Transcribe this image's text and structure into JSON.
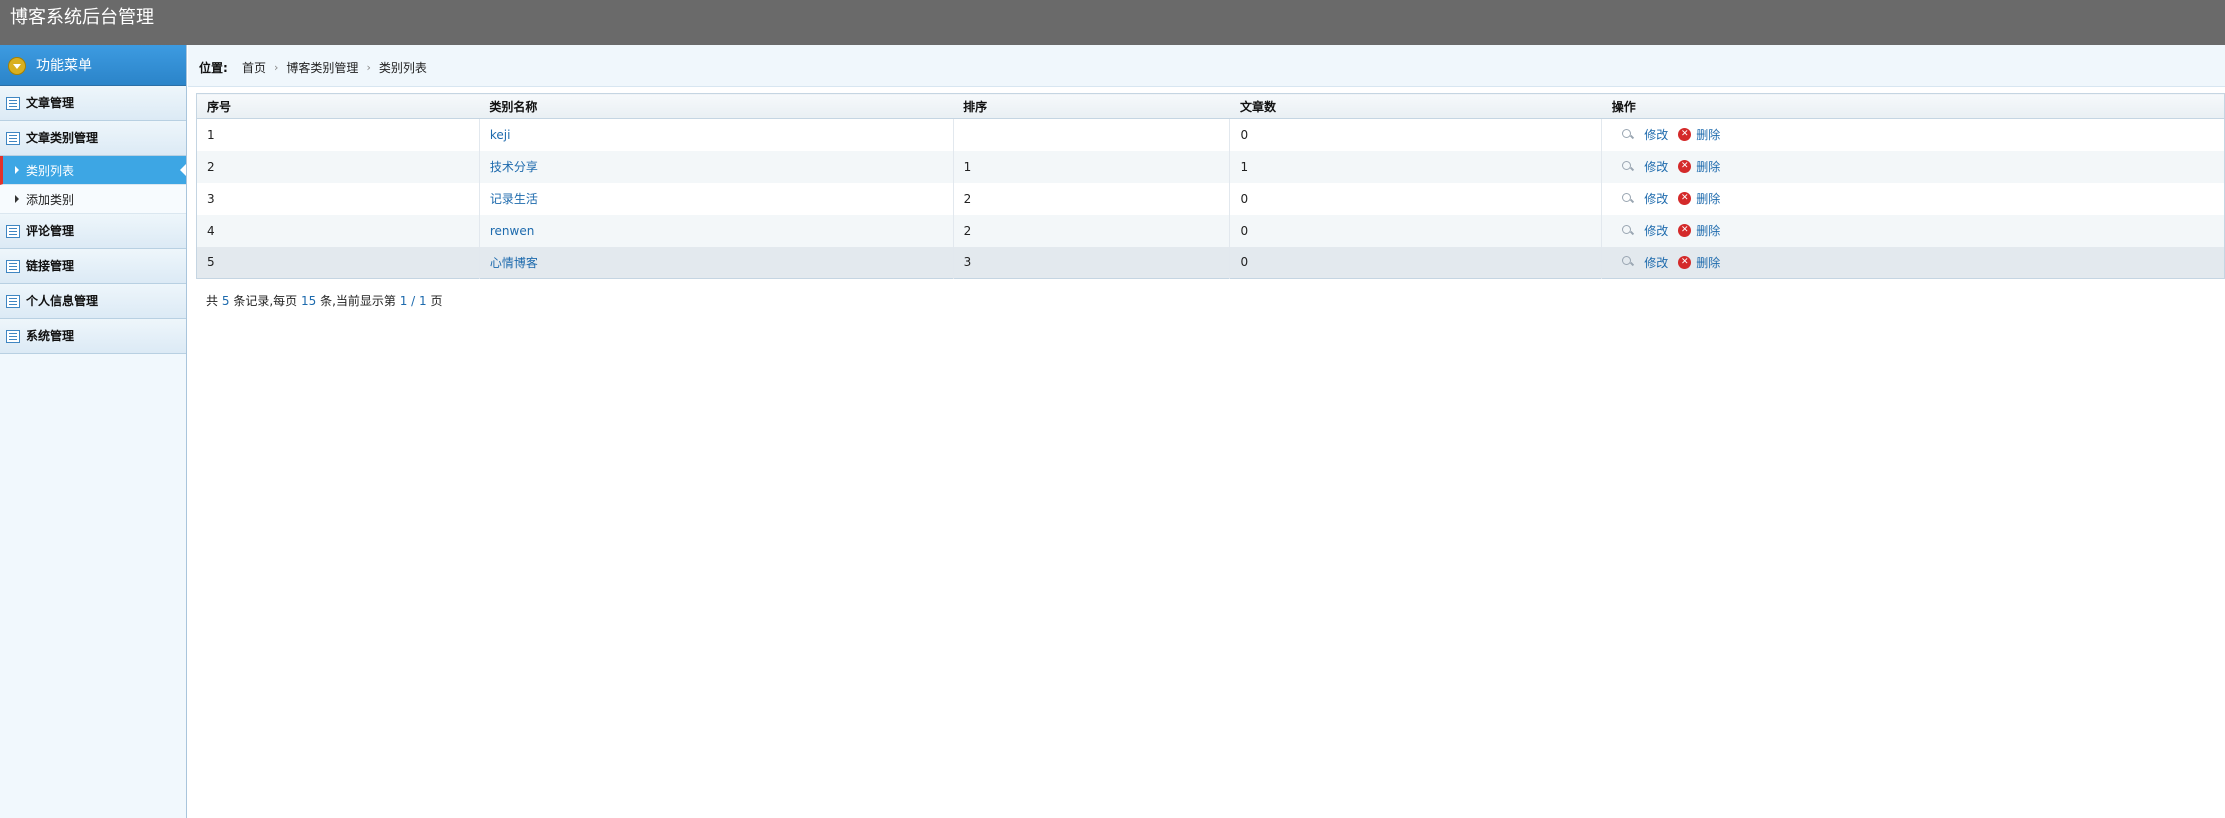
{
  "header": {
    "title": "博客系统后台管理"
  },
  "sidebar": {
    "menu_title": "功能菜单",
    "groups": [
      {
        "label": "文章管理"
      },
      {
        "label": "文章类别管理",
        "subitems": [
          {
            "label": "类别列表",
            "active": true
          },
          {
            "label": "添加类别"
          }
        ]
      },
      {
        "label": "评论管理"
      },
      {
        "label": "链接管理"
      },
      {
        "label": "个人信息管理"
      },
      {
        "label": "系统管理"
      }
    ]
  },
  "breadcrumb": {
    "lead": "位置:",
    "items": [
      "首页",
      "博客类别管理",
      "类别列表"
    ]
  },
  "table": {
    "columns": [
      "序号",
      "类别名称",
      "排序",
      "文章数",
      "操作"
    ],
    "rows": [
      {
        "id": "1",
        "name": "keji",
        "order": "",
        "count": "0"
      },
      {
        "id": "2",
        "name": "技术分享",
        "order": "1",
        "count": "1"
      },
      {
        "id": "3",
        "name": "记录生活",
        "order": "2",
        "count": "0"
      },
      {
        "id": "4",
        "name": "renwen",
        "order": "2",
        "count": "0"
      },
      {
        "id": "5",
        "name": "心情博客",
        "order": "3",
        "count": "0"
      }
    ],
    "edit_label": "修改",
    "delete_label": "删除"
  },
  "pager": {
    "prefix": "共",
    "total": "5",
    "records_per": "条记录,每页",
    "per_page": "15",
    "current_text": "条,当前显示第",
    "current": "1 / 1",
    "suffix": "页"
  }
}
